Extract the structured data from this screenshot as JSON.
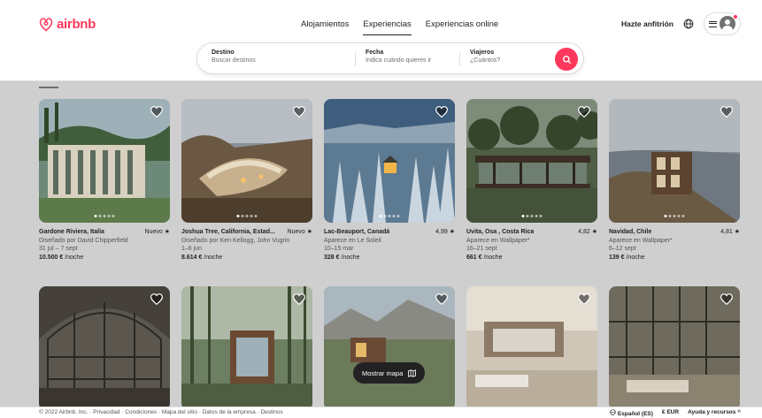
{
  "brand": {
    "name": "airbnb",
    "color": "#ff385c"
  },
  "nav": {
    "tabs": [
      "Alojamientos",
      "Experiencias",
      "Experiencias online"
    ],
    "active": 1
  },
  "header_right": {
    "host_label": "Hazte anfitrión",
    "globe_icon": "globe-icon",
    "menu_icon": "hamburger-icon",
    "avatar_icon": "user-avatar-icon"
  },
  "search": {
    "destination": {
      "label": "Destino",
      "placeholder": "Buscar destinos"
    },
    "date": {
      "label": "Fecha",
      "placeholder": "Indica cuándo quieres ir"
    },
    "travelers": {
      "label": "Viajeros",
      "placeholder": "¿Cuántos?"
    },
    "button_icon": "search-icon"
  },
  "listings": [
    {
      "title": "Gardone Riviera, Italia",
      "rating": "Nuevo ★",
      "subtitle": "Diseñado por David Chipperfield",
      "dates": "31 jul – 7 sept",
      "price": "10.500 €",
      "price_unit": " /noche"
    },
    {
      "title": "Joshua Tree, California, Estad...",
      "rating": "Nuevo ★",
      "subtitle": "Diseñado por Ken Kellogg, John Vugrin",
      "dates": "1–6 jun",
      "price": "8.614 €",
      "price_unit": " /noche"
    },
    {
      "title": "Lac-Beauport, Canadá",
      "rating": "4,99 ★",
      "subtitle": "Aparece en Le Soleil",
      "dates": "10–15 mar",
      "price": "328 €",
      "price_unit": " /noche"
    },
    {
      "title": "Uvita, Osa , Costa Rica",
      "rating": "4,82 ★",
      "subtitle": "Aparece en Wallpaper*",
      "dates": "16–21 sept",
      "price": "661 €",
      "price_unit": " /noche"
    },
    {
      "title": "Navidad, Chile",
      "rating": "4,81 ★",
      "subtitle": "Aparece en Wallpaper*",
      "dates": "6–12 sept",
      "price": "139 €",
      "price_unit": " /noche"
    }
  ],
  "map_button": {
    "label": "Mostrar mapa",
    "icon": "map-icon"
  },
  "footer": {
    "left": "© 2022 Airbnb, Inc. · Privacidad · Condiciones · Mapa del sitio · Datos de la empresa · Destinos",
    "language": "Español (ES)",
    "currency": "€ EUR",
    "help": "Ayuda y recursos ^"
  }
}
